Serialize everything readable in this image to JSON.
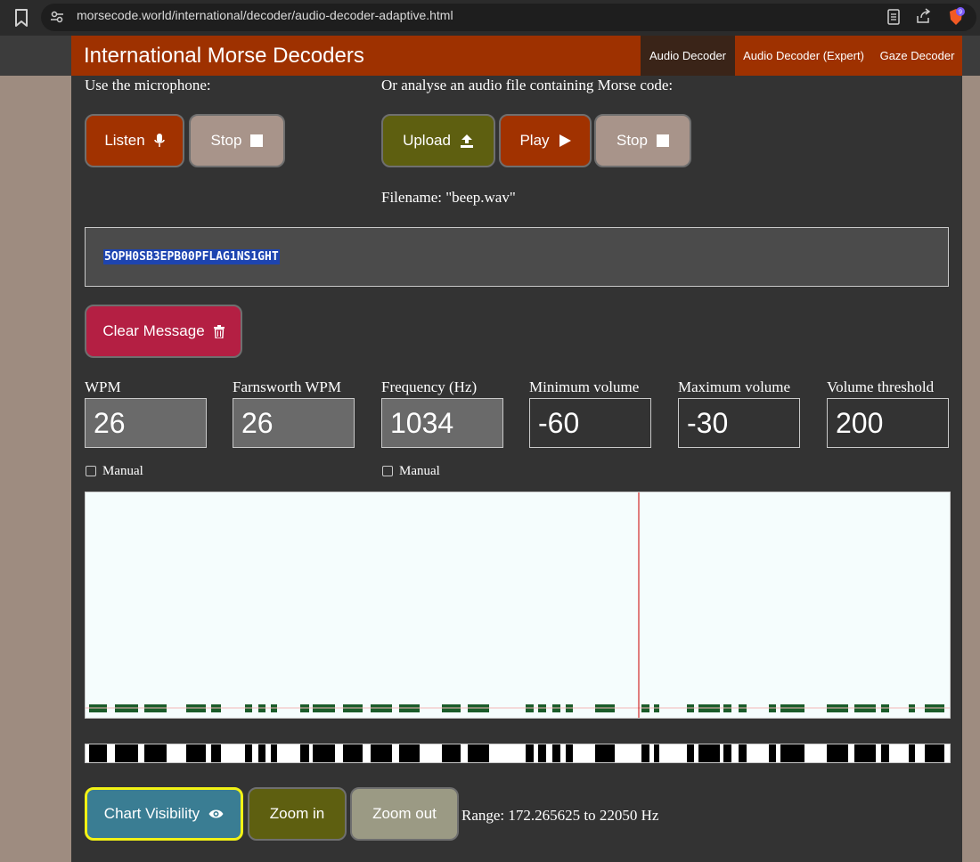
{
  "browser": {
    "url": "morsecode.world/international/decoder/audio-decoder-adaptive.html",
    "brave_badge": "9"
  },
  "header": {
    "title": "International Morse Decoders",
    "tabs": [
      {
        "label": "Audio Decoder",
        "active": true
      },
      {
        "label": "Audio Decoder (Expert)",
        "active": false
      },
      {
        "label": "Gaze Decoder",
        "active": false
      }
    ]
  },
  "microphone": {
    "heading": "Use the microphone:",
    "listen_label": "Listen",
    "stop_label": "Stop"
  },
  "file": {
    "heading": "Or analyse an audio file containing Morse code:",
    "upload_label": "Upload",
    "play_label": "Play",
    "stop_label": "Stop",
    "filename_text": "Filename: \"beep.wav\""
  },
  "message": {
    "decoded_text": "5OPH0SB3EPB00PFLAG1NS1GHT",
    "clear_label": "Clear Message"
  },
  "settings": {
    "wpm_label": "WPM",
    "wpm_value": "26",
    "farnsworth_label": "Farnsworth WPM",
    "farnsworth_value": "26",
    "frequency_label": "Frequency (Hz)",
    "frequency_value": "1034",
    "min_volume_label": "Minimum volume",
    "min_volume_value": "-60",
    "max_volume_label": "Maximum volume",
    "max_volume_value": "-30",
    "threshold_label": "Volume threshold",
    "threshold_value": "200",
    "manual_label_1": "Manual",
    "manual_label_2": "Manual",
    "manual_1_checked": false,
    "manual_2_checked": false
  },
  "chart": {
    "background": "#f5fdfd",
    "signal_color": "#1a5c2a",
    "marker_color": "#cc0000",
    "frequency_marker_fraction": 0.64
  },
  "chart_controls": {
    "visibility_label": "Chart Visibility",
    "zoom_in_label": "Zoom in",
    "zoom_out_label": "Zoom out",
    "range_text": "Range: 172.265625 to 22050 Hz"
  }
}
